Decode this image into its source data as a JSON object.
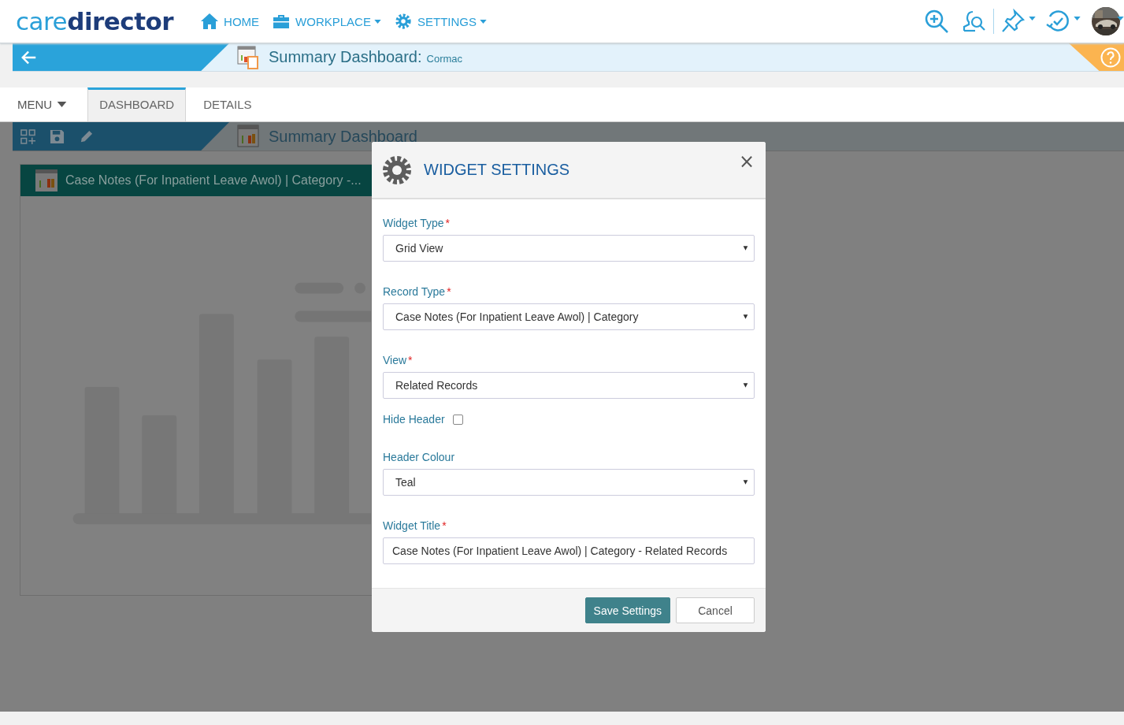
{
  "logo": {
    "light": "care",
    "bold": "director"
  },
  "nav": [
    {
      "label": "HOME",
      "kind": "home",
      "dropdown": false
    },
    {
      "label": "WORKPLACE",
      "kind": "workplace",
      "dropdown": true
    },
    {
      "label": "SETTINGS",
      "kind": "settings",
      "dropdown": true
    }
  ],
  "breadcrumb": {
    "title": "Summary Dashboard:",
    "subtitle": "Cormac"
  },
  "tabs": [
    {
      "label": "MENU",
      "kind": "menu",
      "selected": false
    },
    {
      "label": "DASHBOARD",
      "kind": "tab",
      "selected": true
    },
    {
      "label": "DETAILS",
      "kind": "tab",
      "selected": false
    }
  ],
  "toolbar": {
    "title": "Summary Dashboard"
  },
  "widget": {
    "title": "Case Notes (For Inpatient Leave Awol) | Category -..."
  },
  "dialog": {
    "title": "WIDGET SETTINGS",
    "close": "×",
    "fields": [
      {
        "kind": "select",
        "label": "Widget Type",
        "required_mark": "*",
        "value": "Grid View"
      },
      {
        "kind": "select",
        "label": "Record Type",
        "required_mark": "*",
        "value": "Case Notes (For Inpatient Leave Awol) | Category"
      },
      {
        "kind": "select",
        "label": "View",
        "required_mark": "*",
        "value": "Related Records"
      },
      {
        "kind": "checkbox",
        "label": "Hide Header",
        "checked": false
      },
      {
        "kind": "select",
        "label": "Header Colour",
        "value": "Teal"
      },
      {
        "kind": "text",
        "label": "Widget Title",
        "required_mark": "*",
        "value": "Case Notes (For Inpatient Leave Awol) | Category - Related Records"
      }
    ],
    "buttons": [
      {
        "label": "Save Settings",
        "kind": "primary"
      },
      {
        "label": "Cancel",
        "kind": "secondary"
      }
    ]
  }
}
